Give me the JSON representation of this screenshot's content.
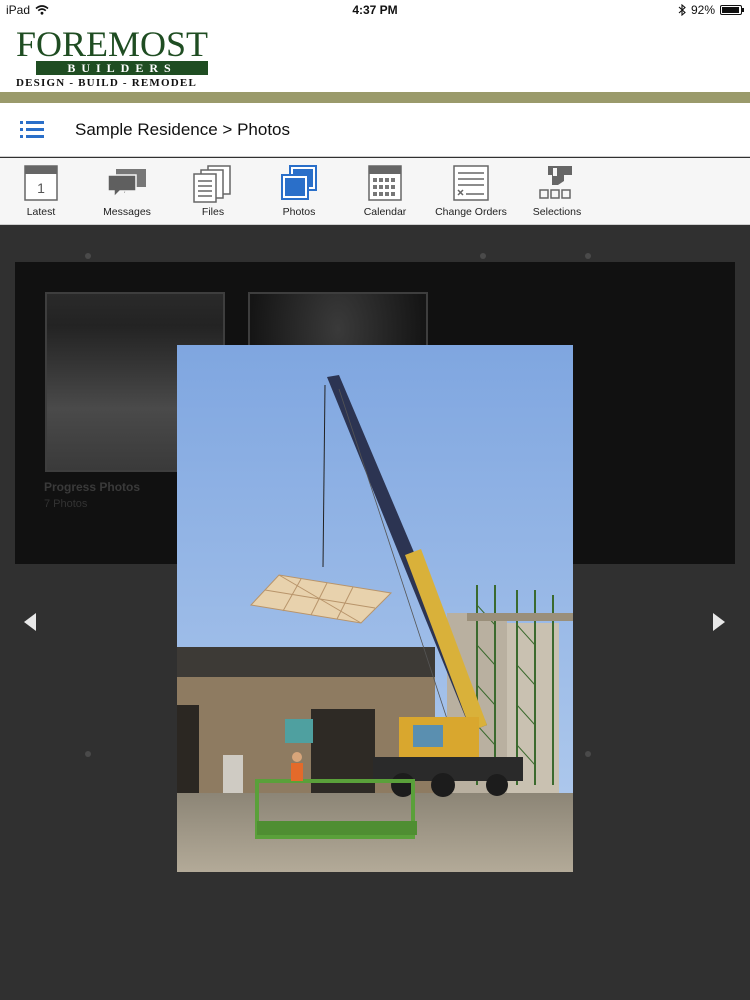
{
  "status_bar": {
    "device": "iPad",
    "time": "4:37 PM",
    "battery": "92%",
    "battery_level": 0.92
  },
  "logo": {
    "main": "FOREMOST",
    "sub": "BUILDERS",
    "tagline": "DESIGN - BUILD - REMODEL"
  },
  "nav": {
    "breadcrumb": "Sample Residence > Photos"
  },
  "toolbar": {
    "items": [
      {
        "label": "Latest",
        "icon": "calendar-day-icon",
        "day": "1"
      },
      {
        "label": "Messages",
        "icon": "chat-bubbles-icon"
      },
      {
        "label": "Files",
        "icon": "documents-icon"
      },
      {
        "label": "Photos",
        "icon": "photos-icon",
        "active": true
      },
      {
        "label": "Calendar",
        "icon": "calendar-grid-icon"
      },
      {
        "label": "Change Orders",
        "icon": "change-order-icon"
      },
      {
        "label": "Selections",
        "icon": "selections-hand-icon"
      }
    ]
  },
  "albums": [
    {
      "title": "Progress Photos",
      "count": "7 Photos"
    }
  ],
  "colors": {
    "brand_green": "#1f4d22",
    "olive_band": "#9a9a6b",
    "active_blue": "#2a6fc9",
    "background": "#303030"
  }
}
